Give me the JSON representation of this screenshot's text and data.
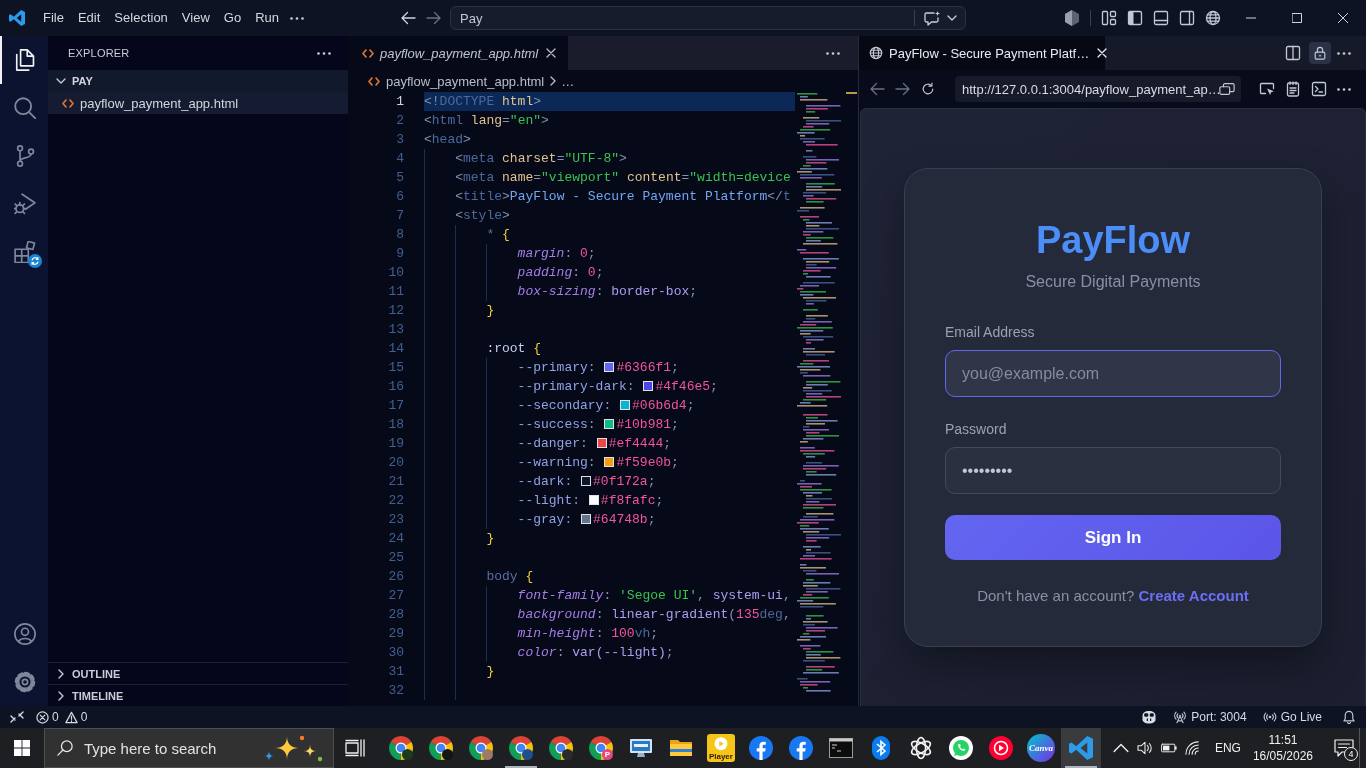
{
  "title_bar": {
    "menu": [
      "File",
      "Edit",
      "Selection",
      "View",
      "Go",
      "Run"
    ],
    "command_center": {
      "value": "Pay"
    }
  },
  "activity_bar": {
    "items": [
      {
        "kind": "files",
        "selected": true,
        "badge": false
      },
      {
        "kind": "search",
        "selected": false,
        "badge": false
      },
      {
        "kind": "source-control",
        "selected": false,
        "badge": false
      },
      {
        "kind": "run-debug",
        "selected": false,
        "badge": false
      },
      {
        "kind": "extensions",
        "selected": false,
        "badge": true
      }
    ],
    "bottom": [
      {
        "kind": "account"
      },
      {
        "kind": "settings"
      }
    ]
  },
  "sidebar": {
    "title": "EXPLORER",
    "folder": {
      "name": "PAY",
      "expanded": true,
      "children": [
        {
          "name": "payflow_payment_app.html",
          "selected": true
        }
      ]
    },
    "sections": [
      {
        "name": "OUTLINE",
        "expanded": false
      },
      {
        "name": "TIMELINE",
        "expanded": false
      }
    ]
  },
  "editor": {
    "tabs": [
      {
        "label": "payflow_payment_app.html",
        "selected": true,
        "preview": true
      }
    ],
    "breadcrumb": [
      "payflow_payment_app.html",
      "…"
    ],
    "lines": [
      {
        "number": "1",
        "selected": true,
        "tokens": [
          {
            "kind": "punct",
            "text": "<!"
          },
          {
            "kind": "tag",
            "text": "DOCTYPE"
          },
          {
            "kind": "attr",
            "text": " html"
          },
          {
            "kind": "punct",
            "text": ">"
          }
        ]
      },
      {
        "number": "2",
        "selected": false,
        "tokens": [
          {
            "kind": "punct",
            "text": "<"
          },
          {
            "kind": "tag",
            "text": "html"
          },
          {
            "kind": "attr",
            "text": " lang"
          },
          {
            "kind": "punct",
            "text": "="
          },
          {
            "kind": "string",
            "text": "\"en\""
          },
          {
            "kind": "punct",
            "text": ">"
          }
        ]
      },
      {
        "number": "3",
        "selected": false,
        "tokens": [
          {
            "kind": "punct",
            "text": "<"
          },
          {
            "kind": "tag",
            "text": "head"
          },
          {
            "kind": "punct",
            "text": ">"
          }
        ]
      },
      {
        "number": "4",
        "selected": false,
        "tokens": [
          {
            "kind": "punct",
            "text": "    <"
          },
          {
            "kind": "tag",
            "text": "meta"
          },
          {
            "kind": "attr",
            "text": " charset"
          },
          {
            "kind": "punct",
            "text": "="
          },
          {
            "kind": "string",
            "text": "\"UTF-8\""
          },
          {
            "kind": "punct",
            "text": ">"
          }
        ]
      },
      {
        "number": "5",
        "selected": false,
        "tokens": [
          {
            "kind": "punct",
            "text": "    <"
          },
          {
            "kind": "tag",
            "text": "meta"
          },
          {
            "kind": "attr",
            "text": " name"
          },
          {
            "kind": "punct",
            "text": "="
          },
          {
            "kind": "string",
            "text": "\"viewport\""
          },
          {
            "kind": "attr",
            "text": " content"
          },
          {
            "kind": "punct",
            "text": "="
          },
          {
            "kind": "string",
            "text": "\"width=device"
          }
        ]
      },
      {
        "number": "6",
        "selected": false,
        "tokens": [
          {
            "kind": "punct",
            "text": "    <"
          },
          {
            "kind": "tag",
            "text": "title"
          },
          {
            "kind": "punct",
            "text": ">"
          },
          {
            "kind": "text",
            "text": "PayFlow - Secure Payment Platform"
          },
          {
            "kind": "punct",
            "text": "</"
          },
          {
            "kind": "tag",
            "text": "t"
          }
        ]
      },
      {
        "number": "7",
        "selected": false,
        "tokens": [
          {
            "kind": "punct",
            "text": "    <"
          },
          {
            "kind": "tag",
            "text": "style"
          },
          {
            "kind": "punct",
            "text": ">"
          }
        ]
      },
      {
        "number": "8",
        "selected": false,
        "tokens": [
          {
            "kind": "selector",
            "text": "        *"
          },
          {
            "kind": "brace",
            "text": " {"
          }
        ]
      },
      {
        "number": "9",
        "selected": false,
        "tokens": [
          {
            "kind": "prop",
            "text": "            margin"
          },
          {
            "kind": "punct",
            "text": ": "
          },
          {
            "kind": "number",
            "text": "0"
          },
          {
            "kind": "punct",
            "text": ";"
          }
        ]
      },
      {
        "number": "10",
        "selected": false,
        "tokens": [
          {
            "kind": "prop",
            "text": "            padding"
          },
          {
            "kind": "punct",
            "text": ": "
          },
          {
            "kind": "number",
            "text": "0"
          },
          {
            "kind": "punct",
            "text": ";"
          }
        ]
      },
      {
        "number": "11",
        "selected": false,
        "tokens": [
          {
            "kind": "prop",
            "text": "            box-sizing"
          },
          {
            "kind": "punct",
            "text": ": "
          },
          {
            "kind": "value",
            "text": "border-box"
          },
          {
            "kind": "punct",
            "text": ";"
          }
        ]
      },
      {
        "number": "12",
        "selected": false,
        "tokens": [
          {
            "kind": "brace",
            "text": "        }"
          }
        ]
      },
      {
        "number": "13",
        "selected": false
      },
      {
        "number": "14",
        "selected": false,
        "tokens": [
          {
            "kind": "pseudo",
            "text": "        :root"
          },
          {
            "kind": "brace",
            "text": " {"
          }
        ]
      },
      {
        "number": "15",
        "selected": false,
        "tokens": [
          {
            "kind": "var",
            "text": "            --primary"
          },
          {
            "kind": "punct",
            "text": ": "
          },
          {
            "kind": "swatch",
            "color": "#6366f1"
          },
          {
            "kind": "number",
            "text": "#6366f1"
          },
          {
            "kind": "punct",
            "text": ";"
          }
        ]
      },
      {
        "number": "16",
        "selected": false,
        "tokens": [
          {
            "kind": "var",
            "text": "            --primary-dark"
          },
          {
            "kind": "punct",
            "text": ": "
          },
          {
            "kind": "swatch",
            "color": "#4f46e5"
          },
          {
            "kind": "number",
            "text": "#4f46e5"
          },
          {
            "kind": "punct",
            "text": ";"
          }
        ]
      },
      {
        "number": "17",
        "selected": false,
        "tokens": [
          {
            "kind": "var",
            "text": "            --secondary"
          },
          {
            "kind": "punct",
            "text": ": "
          },
          {
            "kind": "swatch",
            "color": "#06b6d4"
          },
          {
            "kind": "number",
            "text": "#06b6d4"
          },
          {
            "kind": "punct",
            "text": ";"
          }
        ]
      },
      {
        "number": "18",
        "selected": false,
        "tokens": [
          {
            "kind": "var",
            "text": "            --success"
          },
          {
            "kind": "punct",
            "text": ": "
          },
          {
            "kind": "swatch",
            "color": "#10b981"
          },
          {
            "kind": "number",
            "text": "#10b981"
          },
          {
            "kind": "punct",
            "text": ";"
          }
        ]
      },
      {
        "number": "19",
        "selected": false,
        "tokens": [
          {
            "kind": "var",
            "text": "            --danger"
          },
          {
            "kind": "punct",
            "text": ": "
          },
          {
            "kind": "swatch",
            "color": "#ef4444"
          },
          {
            "kind": "number",
            "text": "#ef4444"
          },
          {
            "kind": "punct",
            "text": ";"
          }
        ]
      },
      {
        "number": "20",
        "selected": false,
        "tokens": [
          {
            "kind": "var",
            "text": "            --warning"
          },
          {
            "kind": "punct",
            "text": ": "
          },
          {
            "kind": "swatch",
            "color": "#f59e0b"
          },
          {
            "kind": "number",
            "text": "#f59e0b"
          },
          {
            "kind": "punct",
            "text": ";"
          }
        ]
      },
      {
        "number": "21",
        "selected": false,
        "tokens": [
          {
            "kind": "var",
            "text": "            --dark"
          },
          {
            "kind": "punct",
            "text": ": "
          },
          {
            "kind": "swatch",
            "color": "#0f172a"
          },
          {
            "kind": "number",
            "text": "#0f172a"
          },
          {
            "kind": "punct",
            "text": ";"
          }
        ]
      },
      {
        "number": "22",
        "selected": false,
        "tokens": [
          {
            "kind": "var",
            "text": "            --light"
          },
          {
            "kind": "punct",
            "text": ": "
          },
          {
            "kind": "swatch",
            "color": "#f8fafc"
          },
          {
            "kind": "number",
            "text": "#f8fafc"
          },
          {
            "kind": "punct",
            "text": ";"
          }
        ]
      },
      {
        "number": "23",
        "selected": false,
        "tokens": [
          {
            "kind": "var",
            "text": "            --gray"
          },
          {
            "kind": "punct",
            "text": ": "
          },
          {
            "kind": "swatch",
            "color": "#64748b"
          },
          {
            "kind": "number",
            "text": "#64748b"
          },
          {
            "kind": "punct",
            "text": ";"
          }
        ]
      },
      {
        "number": "24",
        "selected": false,
        "tokens": [
          {
            "kind": "brace",
            "text": "        }"
          }
        ]
      },
      {
        "number": "25",
        "selected": false
      },
      {
        "number": "26",
        "selected": false,
        "tokens": [
          {
            "kind": "selector",
            "text": "        body"
          },
          {
            "kind": "brace",
            "text": " {"
          }
        ]
      },
      {
        "number": "27",
        "selected": false,
        "tokens": [
          {
            "kind": "prop",
            "text": "            font-family"
          },
          {
            "kind": "punct",
            "text": ": "
          },
          {
            "kind": "string",
            "text": "'Segoe UI'"
          },
          {
            "kind": "punct",
            "text": ", "
          },
          {
            "kind": "value",
            "text": "system-ui"
          },
          {
            "kind": "punct",
            "text": ","
          }
        ]
      },
      {
        "number": "28",
        "selected": false,
        "tokens": [
          {
            "kind": "prop",
            "text": "            background"
          },
          {
            "kind": "punct",
            "text": ": "
          },
          {
            "kind": "value",
            "text": "linear-gradient"
          },
          {
            "kind": "punct",
            "text": "("
          },
          {
            "kind": "number",
            "text": "135"
          },
          {
            "kind": "unit",
            "text": "deg"
          },
          {
            "kind": "punct",
            "text": ","
          }
        ]
      },
      {
        "number": "29",
        "selected": false,
        "tokens": [
          {
            "kind": "prop",
            "text": "            min-height"
          },
          {
            "kind": "punct",
            "text": ": "
          },
          {
            "kind": "number",
            "text": "100"
          },
          {
            "kind": "unit",
            "text": "vh"
          },
          {
            "kind": "punct",
            "text": ";"
          }
        ]
      },
      {
        "number": "30",
        "selected": false,
        "tokens": [
          {
            "kind": "prop",
            "text": "            color"
          },
          {
            "kind": "punct",
            "text": ": "
          },
          {
            "kind": "value",
            "text": "var(--light)"
          },
          {
            "kind": "punct",
            "text": ";"
          }
        ]
      },
      {
        "number": "31",
        "selected": false,
        "tokens": [
          {
            "kind": "brace",
            "text": "        }"
          }
        ]
      },
      {
        "number": "32",
        "selected": false
      }
    ]
  },
  "browser": {
    "tabs": [
      {
        "label": "PayFlow - Secure Payment Platf…",
        "selected": true
      }
    ],
    "locked": true,
    "address": {
      "value": "http://127.0.0.1:3004/payflow_payment_ap…"
    },
    "page": {
      "brand": "PayFlow",
      "tagline": "Secure Digital Payments",
      "fields": [
        {
          "label": "Email Address",
          "placeholder": "you@example.com",
          "focused": true
        },
        {
          "label": "Password",
          "value": "•••••••••",
          "focused": false
        }
      ],
      "submit": "Sign In",
      "footer": {
        "text": "Don't have an account?",
        "link": "Create Account"
      }
    }
  },
  "status_bar": {
    "problems": {
      "errors": "0",
      "warnings": "0"
    },
    "items": [
      {
        "kind": "copilot"
      },
      {
        "kind": "port",
        "label": "Port: 3004"
      },
      {
        "kind": "live",
        "label": "Go Live"
      },
      {
        "kind": "bell"
      }
    ]
  },
  "taskbar": {
    "search": {
      "placeholder": "Type here to search"
    },
    "apps": [
      {
        "kind": "chrome",
        "color": "#1d3a1c",
        "active": false,
        "running": false
      },
      {
        "kind": "chrome",
        "color": "#151515",
        "active": false,
        "running": false
      },
      {
        "kind": "chrome",
        "color": "#9c7a68",
        "active": false,
        "running": false
      },
      {
        "kind": "chrome",
        "color": "#1f4f8f",
        "active": false,
        "running": true
      },
      {
        "kind": "chrome",
        "color": "#2b2b2b",
        "active": false,
        "running": false
      },
      {
        "kind": "chrome",
        "color": "#e5487f",
        "initial": "P",
        "active": false,
        "running": false
      },
      {
        "kind": "monitor",
        "active": false,
        "running": false
      },
      {
        "kind": "folder",
        "active": false,
        "running": false
      },
      {
        "kind": "player",
        "label": "Player",
        "active": false,
        "running": false
      },
      {
        "kind": "facebook",
        "active": false,
        "running": false
      },
      {
        "kind": "facebook",
        "active": false,
        "running": false
      },
      {
        "kind": "terminal",
        "active": false,
        "running": false
      },
      {
        "kind": "bluetooth",
        "active": false,
        "running": false
      },
      {
        "kind": "knot",
        "active": false,
        "running": false
      },
      {
        "kind": "whatsapp",
        "active": false,
        "running": false
      },
      {
        "kind": "music",
        "active": false,
        "running": false
      },
      {
        "kind": "canva",
        "label": "Canva",
        "active": false,
        "running": false
      },
      {
        "kind": "vscode",
        "active": true,
        "running": true
      }
    ],
    "tray": [
      {
        "kind": "chevron"
      },
      {
        "kind": "volume"
      },
      {
        "kind": "battery"
      },
      {
        "kind": "wifi"
      }
    ],
    "language": "ENG",
    "time": "11:51",
    "date": "16/05/2026",
    "notifications": "4"
  }
}
